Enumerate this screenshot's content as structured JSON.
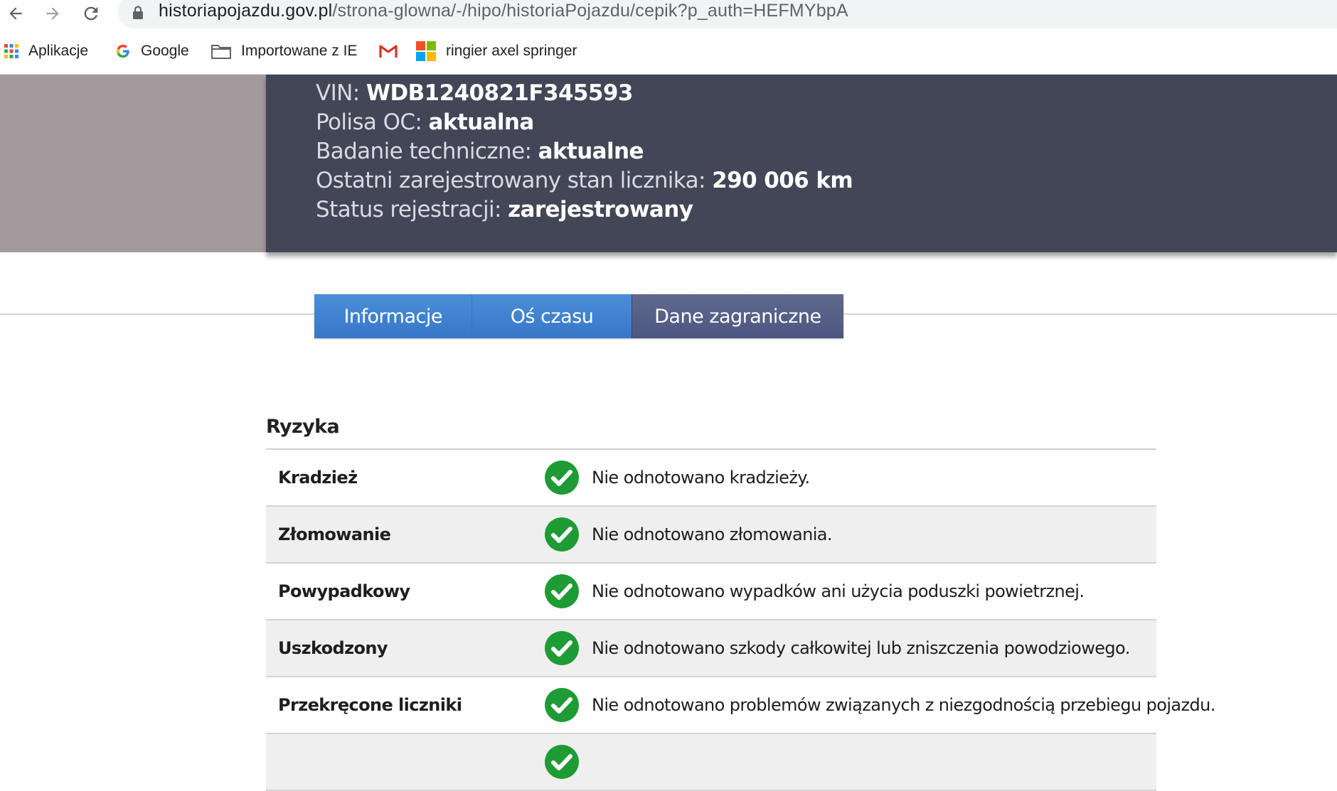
{
  "browser": {
    "url_domain": "historiapojazdu.gov.pl",
    "url_path": "/strona-glowna/-/hipo/historiaPojazdu/cepik?p_auth=HEFMYbpA",
    "bookmarks": [
      {
        "label": "Aplikacje",
        "icon": "apps-grid-icon"
      },
      {
        "label": "Google",
        "icon": "google-icon"
      },
      {
        "label": "Importowane z IE",
        "icon": "folder-icon"
      },
      {
        "label": "",
        "icon": "gmail-icon"
      },
      {
        "label": "ringier axel springer",
        "icon": "windows-logo-icon"
      }
    ]
  },
  "vehicle": {
    "vin_label": "VIN:",
    "vin_value": "WDB1240821F345593",
    "oc_label": "Polisa OC:",
    "oc_value": "aktualna",
    "inspection_label": "Badanie techniczne:",
    "inspection_value": "aktualne",
    "odometer_label": "Ostatni zarejestrowany stan licznika:",
    "odometer_value": "290 006 km",
    "status_label": "Status rejestracji:",
    "status_value": "zarejestrowany"
  },
  "tabs": [
    {
      "label": "Informacje"
    },
    {
      "label": "Oś czasu"
    },
    {
      "label": "Dane zagraniczne"
    }
  ],
  "risks": {
    "title": "Ryzyka",
    "rows": [
      {
        "name": "Kradzież",
        "description": "Nie odnotowano kradzieży."
      },
      {
        "name": "Złomowanie",
        "description": "Nie odnotowano złomowania."
      },
      {
        "name": "Powypadkowy",
        "description": "Nie odnotowano wypadków ani użycia poduszki powietrznej."
      },
      {
        "name": "Uszkodzony",
        "description": "Nie odnotowano szkody całkowitej lub zniszczenia powodziowego."
      },
      {
        "name": "Przekręcone liczniki",
        "description": "Nie odnotowano problemów związanych z niezgodnością przebiegu pojazdu."
      }
    ]
  },
  "colors": {
    "hero_card": "#424656",
    "tab_blue": "#3f82cf",
    "tab_slate": "#566089",
    "check_green": "#1e9b35"
  }
}
